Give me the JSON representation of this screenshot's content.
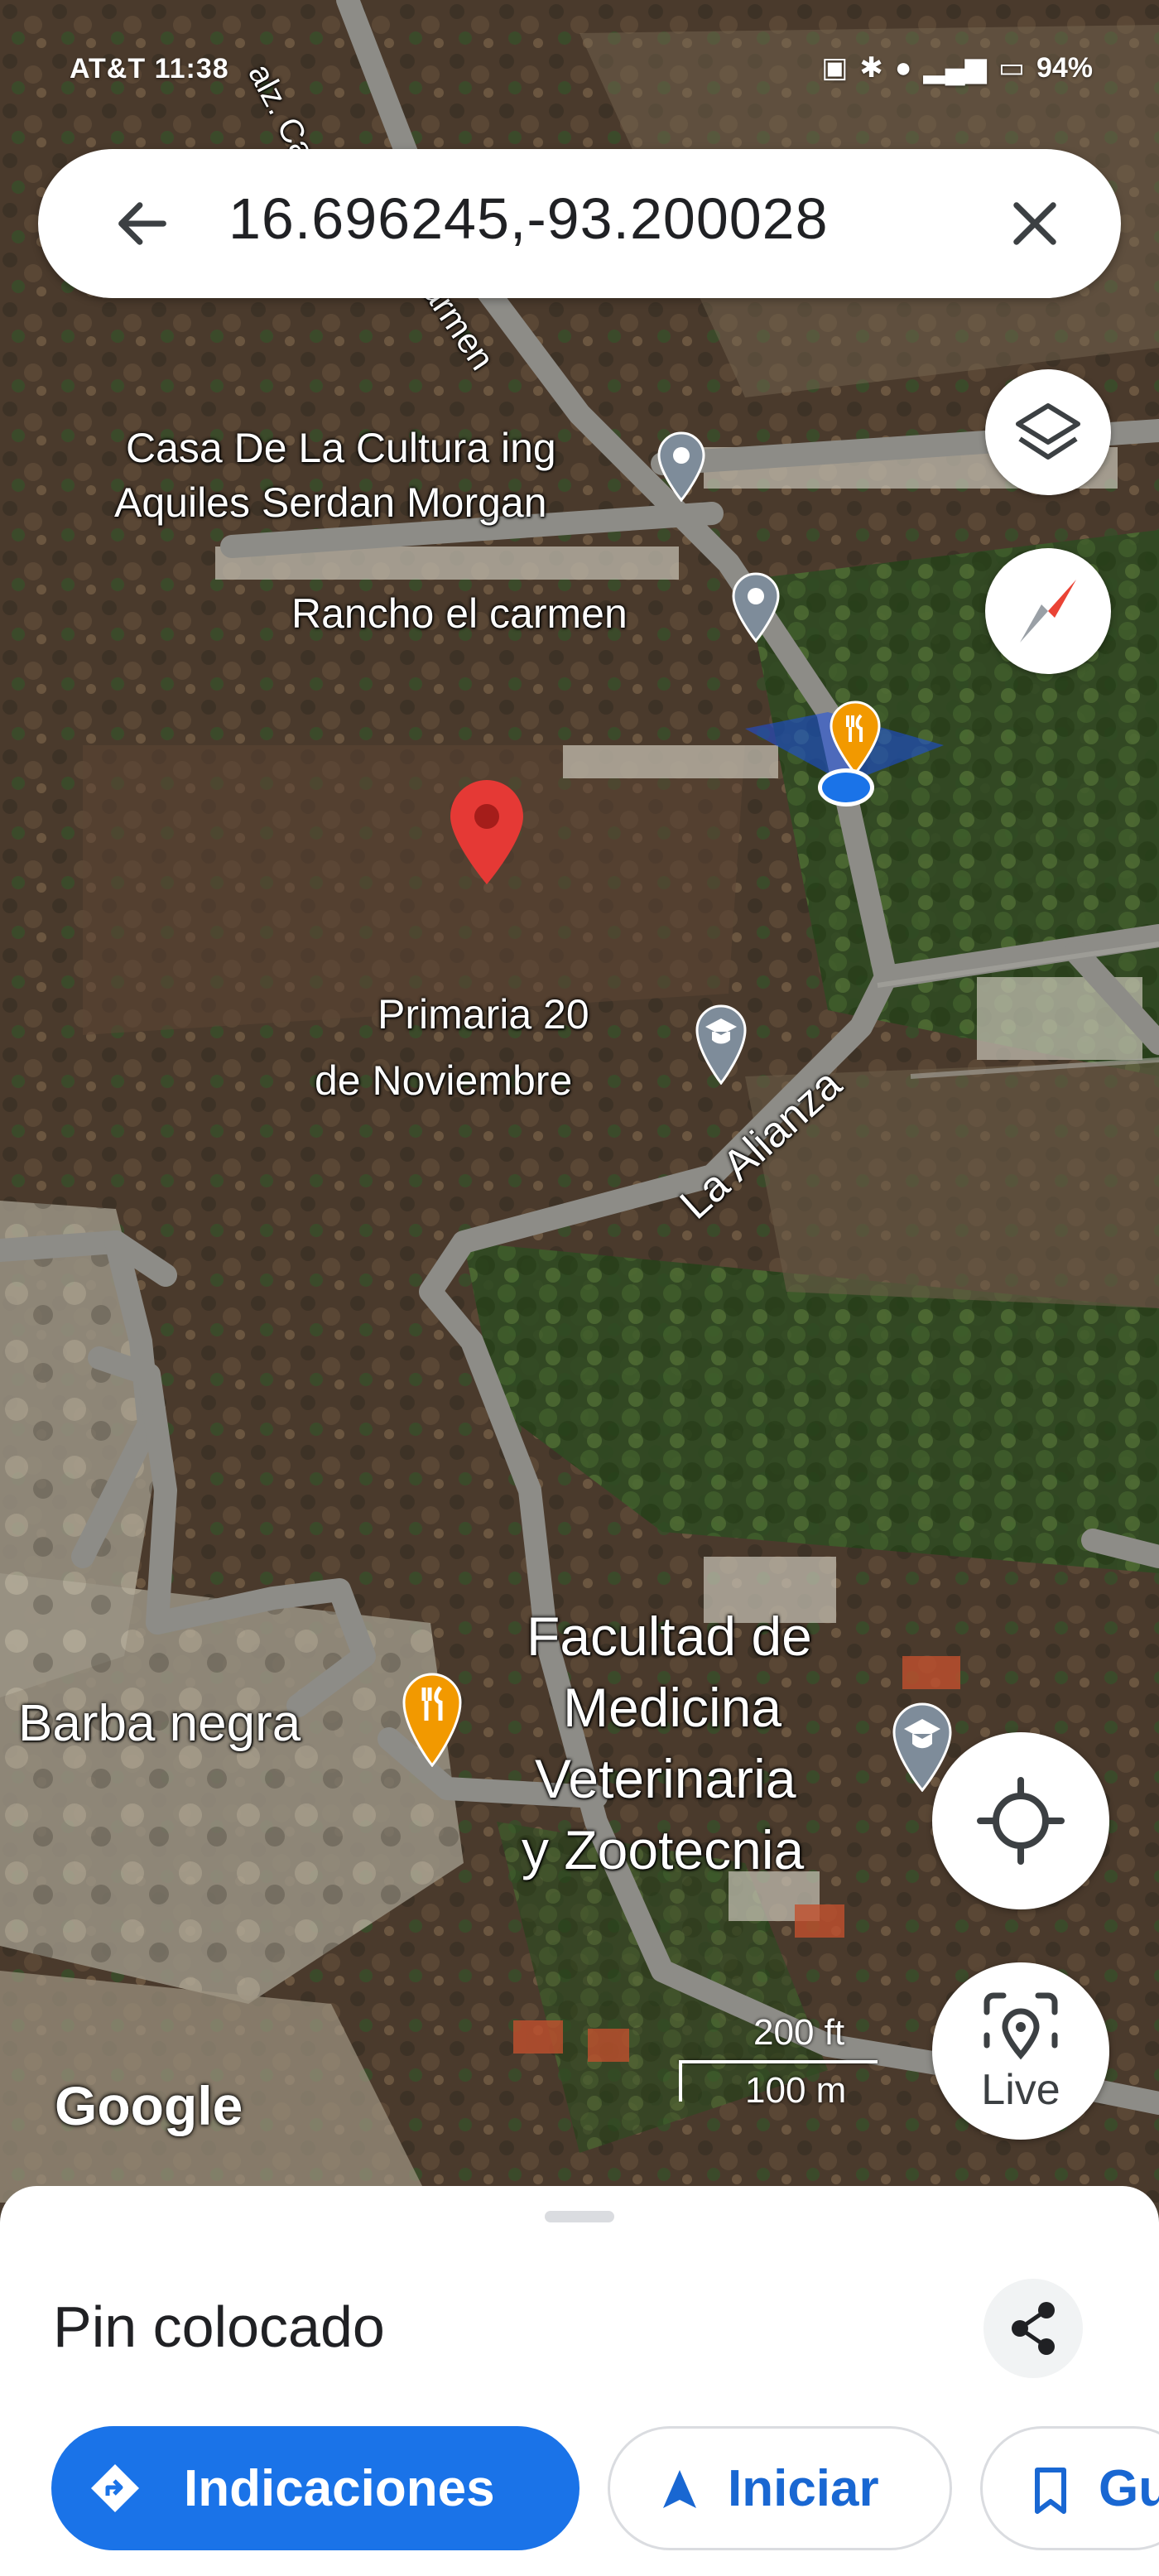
{
  "status_bar": {
    "carrier_time": "AT&T 11:38",
    "battery": "94%"
  },
  "search": {
    "query": "16.696245,-93.200028"
  },
  "map": {
    "places": {
      "casa_cultura": "Casa De La Cultura ing Aquiles Serdan Morgan",
      "casa_cultura_line1": "Casa De La Cultura ing",
      "casa_cultura_line2": "Aquiles Serdan Morgan",
      "rancho": "Rancho el carmen",
      "primaria_line1": "Primaria 20",
      "primaria_line2": "de Noviembre",
      "facultad_line1": "Facultad de",
      "facultad_line2": "Medicina",
      "facultad_line3": "Veterinaria",
      "facultad_line4": "y Zootecnia",
      "barba_negra": "Barba negra"
    },
    "roads": {
      "la_alianza": "La Alianza",
      "calz_carmen_top": "alz. Campi",
      "calz_carmen_mid": "armen"
    },
    "attribution": "Google",
    "scale": {
      "imperial": "200 ft",
      "metric": "100 m"
    },
    "live_label": "Live",
    "icons": [
      "layers-icon",
      "compass-icon",
      "my-location-icon",
      "live-view-icon"
    ]
  },
  "sheet": {
    "title": "Pin colocado",
    "directions_label": "Indicaciones",
    "start_label": "Iniciar",
    "save_label": "Gu"
  },
  "colors": {
    "primary": "#1a73e8",
    "pin_red": "#e53935",
    "poi_gray": "#7e8c9a",
    "food_orange": "#f29900"
  }
}
